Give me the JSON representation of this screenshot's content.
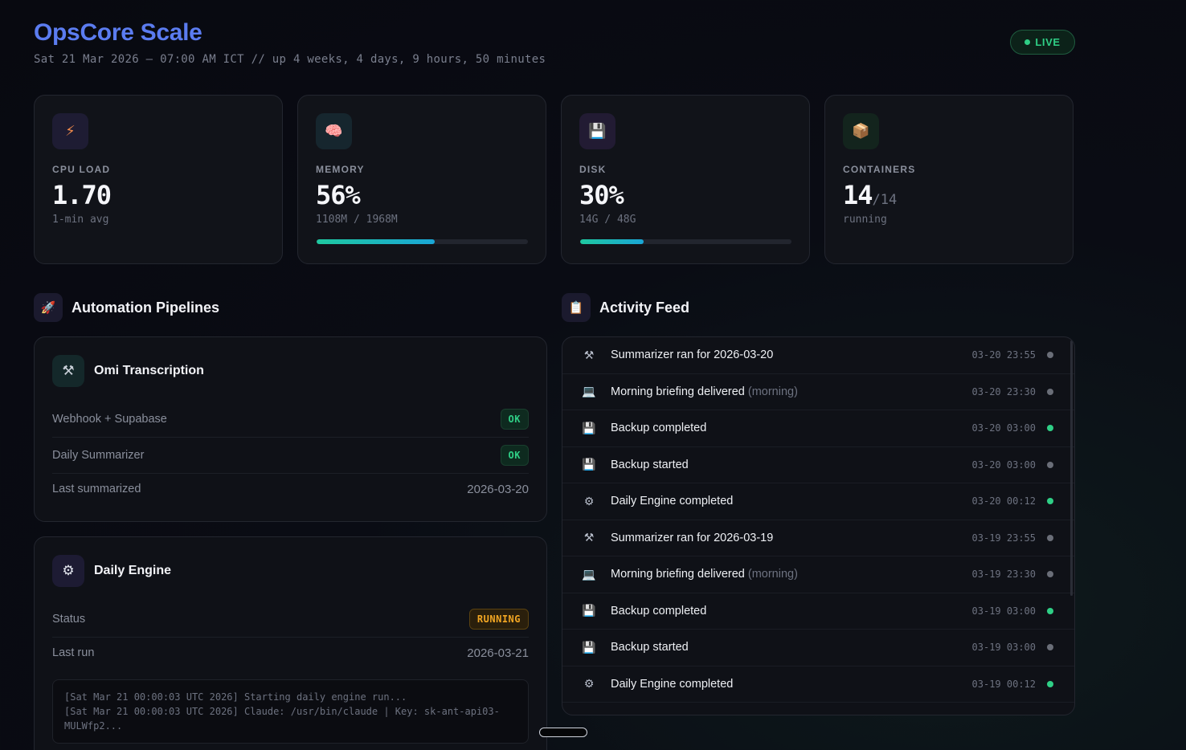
{
  "header": {
    "title": "OpsCore Scale",
    "subtitle": "Sat 21 Mar 2026 — 07:00 AM ICT // up 4 weeks, 4 days, 9 hours, 50 minutes",
    "live_label": "LIVE"
  },
  "cards": {
    "cpu": {
      "icon": "lightning-icon",
      "label": "CPU LOAD",
      "value": "1.70",
      "sub": "1-min avg"
    },
    "memory": {
      "icon": "brain-icon",
      "label": "MEMORY",
      "value": "56%",
      "sub": "1108M / 1968M",
      "progress": 0.56
    },
    "disk": {
      "icon": "floppy-disk-icon",
      "label": "DISK",
      "value": "30%",
      "sub": "14G / 48G",
      "progress": 0.3
    },
    "containers": {
      "icon": "package-icon",
      "label": "CONTAINERS",
      "value": "14",
      "total": "/14",
      "sub": "running"
    }
  },
  "pipelines": {
    "title": "Automation Pipelines",
    "omi": {
      "name": "Omi Transcription",
      "rows": [
        {
          "label": "Webhook + Supabase",
          "status": "OK"
        },
        {
          "label": "Daily Summarizer",
          "status": "OK"
        },
        {
          "label": "Last summarized",
          "value": "2026-03-20"
        }
      ]
    },
    "engine": {
      "name": "Daily Engine",
      "status_label": "Status",
      "status": "RUNNING",
      "last_run_label": "Last run",
      "last_run": "2026-03-21",
      "log_lines": [
        "[Sat Mar 21 00:00:03 UTC 2026] Starting daily engine run...",
        "[Sat Mar 21 00:00:03 UTC 2026] Claude: /usr/bin/claude | Key: sk-ant-api03-MULWfp2..."
      ]
    }
  },
  "activity": {
    "title": "Activity Feed",
    "items": [
      {
        "icon": "pickaxe-icon",
        "glyph": "⚒",
        "text": "Summarizer ran for 2026-03-20",
        "detail": "",
        "time": "03-20 23:55",
        "status": "neutral"
      },
      {
        "icon": "laptop-icon",
        "glyph": "💻",
        "text": "Morning briefing delivered",
        "detail": "(morning)",
        "time": "03-20 23:30",
        "status": "neutral"
      },
      {
        "icon": "floppy-disk-icon",
        "glyph": "💾",
        "text": "Backup completed",
        "detail": "",
        "time": "03-20 03:00",
        "status": "success"
      },
      {
        "icon": "floppy-disk-icon",
        "glyph": "💾",
        "text": "Backup started",
        "detail": "",
        "time": "03-20 03:00",
        "status": "neutral"
      },
      {
        "icon": "gear-icon",
        "glyph": "⚙",
        "text": "Daily Engine completed",
        "detail": "",
        "time": "03-20 00:12",
        "status": "success"
      },
      {
        "icon": "pickaxe-icon",
        "glyph": "⚒",
        "text": "Summarizer ran for 2026-03-19",
        "detail": "",
        "time": "03-19 23:55",
        "status": "neutral"
      },
      {
        "icon": "laptop-icon",
        "glyph": "💻",
        "text": "Morning briefing delivered",
        "detail": "(morning)",
        "time": "03-19 23:30",
        "status": "neutral"
      },
      {
        "icon": "floppy-disk-icon",
        "glyph": "💾",
        "text": "Backup completed",
        "detail": "",
        "time": "03-19 03:00",
        "status": "success"
      },
      {
        "icon": "floppy-disk-icon",
        "glyph": "💾",
        "text": "Backup started",
        "detail": "",
        "time": "03-19 03:00",
        "status": "neutral"
      },
      {
        "icon": "gear-icon",
        "glyph": "⚙",
        "text": "Daily Engine completed",
        "detail": "",
        "time": "03-19 00:12",
        "status": "success"
      }
    ]
  },
  "colors": {
    "accent": "#5b7cf0",
    "success": "#2fcf86",
    "warning": "#f2a623",
    "neutral_dot": "#6a6e78"
  }
}
